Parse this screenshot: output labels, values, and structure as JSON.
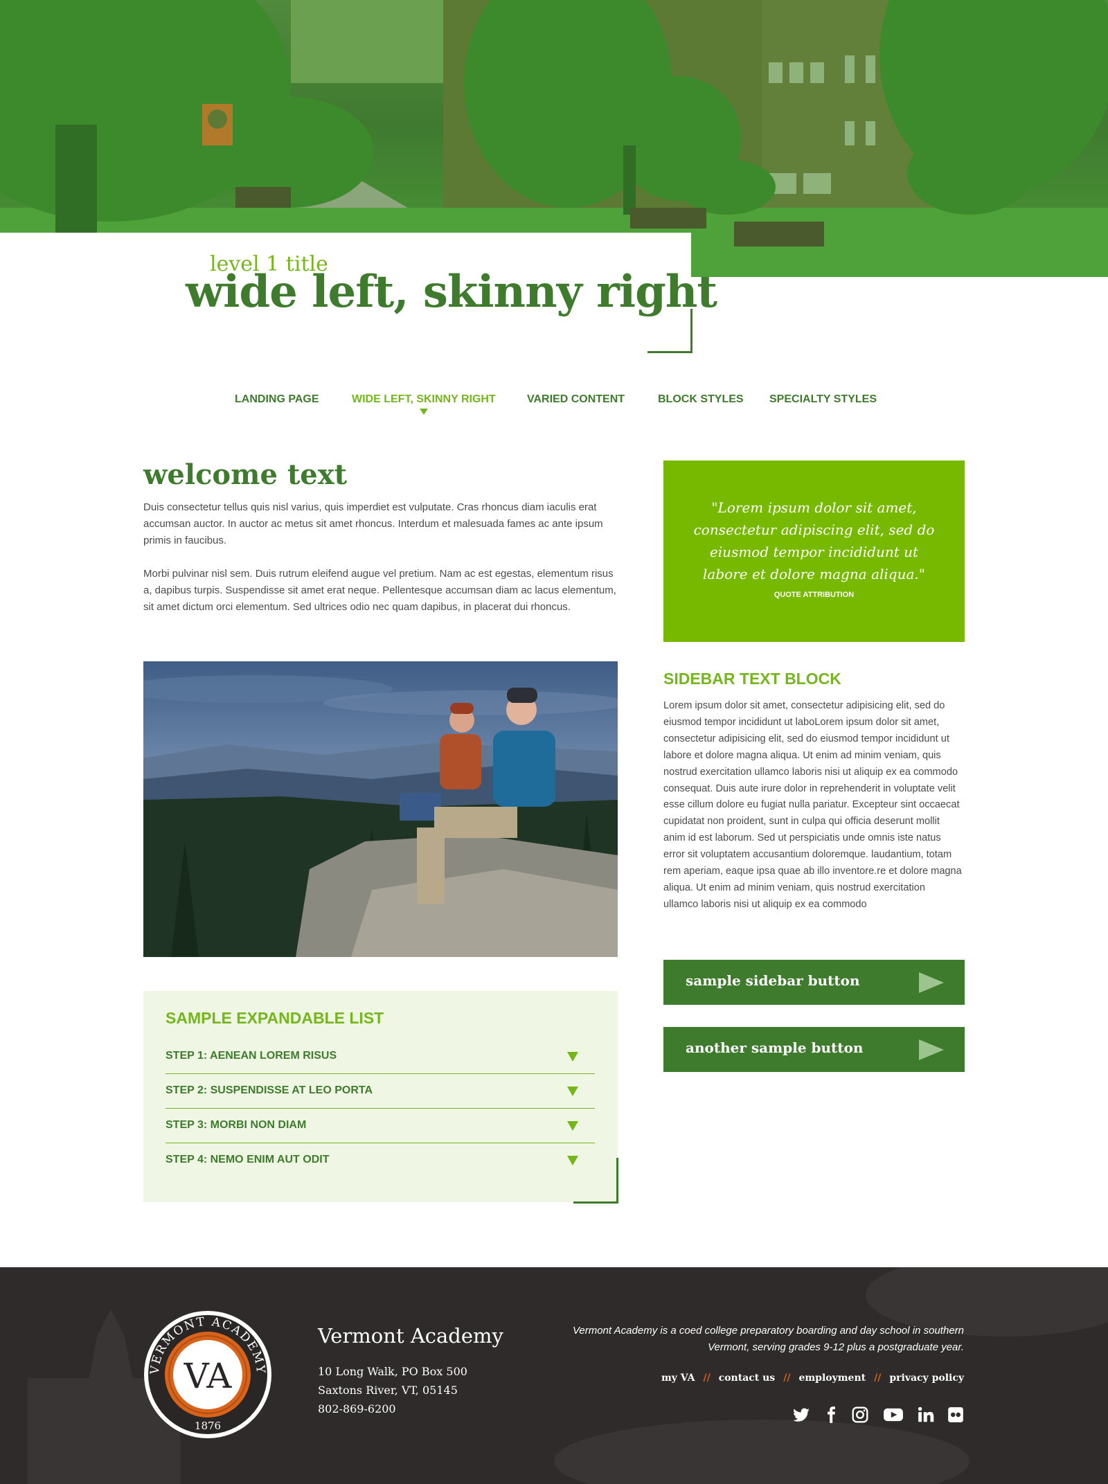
{
  "hero": {
    "kicker": "level 1 title",
    "title": "wide left, skinny right"
  },
  "nav": {
    "items": [
      {
        "label": "LANDING PAGE"
      },
      {
        "label": "WIDE LEFT, SKINNY RIGHT",
        "active": true
      },
      {
        "label": "VARIED CONTENT"
      },
      {
        "label": "BLOCK STYLES"
      },
      {
        "label": "SPECIALTY STYLES"
      }
    ]
  },
  "main": {
    "heading": "welcome text",
    "paragraphs": [
      "Duis consectetur tellus quis nisl varius, quis imperdiet est vulputate. Cras rhoncus diam iaculis erat accumsan auctor. In auctor ac metus sit amet rhoncus. Interdum et malesuada fames ac ante ipsum primis in faucibus.",
      "Morbi pulvinar nisl sem. Duis rutrum eleifend augue vel pretium. Nam ac est egestas, elementum risus a, dapibus turpis. Suspendisse sit amet erat neque. Pellentesque accumsan diam ac lacus elementum, sit amet dictum orci elementum. Sed ultrices odio nec quam dapibus, in placerat dui rhoncus."
    ],
    "expandable": {
      "title": "SAMPLE EXPANDABLE LIST",
      "items": [
        {
          "label": "STEP 1: AENEAN LOREM RISUS"
        },
        {
          "label": "STEP 2: SUSPENDISSE AT LEO PORTA"
        },
        {
          "label": "STEP 3: MORBI NON DIAM"
        },
        {
          "label": "STEP 4: NEMO ENIM AUT ODIT"
        }
      ]
    }
  },
  "sidebar": {
    "quote": "\"Lorem ipsum dolor sit amet, consectetur adipiscing elit, sed do eiusmod tempor incididunt ut labore et dolore magna aliqua.\"",
    "quote_attribution": "QUOTE ATTRIBUTION",
    "text_block_title": "SIDEBAR TEXT BLOCK",
    "text_block": "Lorem ipsum dolor sit amet, consectetur adipisicing elit, sed do eiusmod tempor incididunt ut laboLorem ipsum dolor sit amet, consectetur adipisicing elit, sed do eiusmod tempor incididunt ut labore et dolore magna aliqua. Ut enim ad minim veniam, quis nostrud exercitation ullamco laboris nisi ut aliquip ex ea commodo consequat. Duis aute irure dolor in reprehenderit in voluptate velit esse cillum dolore eu fugiat nulla pariatur. Excepteur sint occaecat cupidatat non proident, sunt in culpa qui officia deserunt mollit anim id est laborum. Sed ut perspiciatis unde omnis iste natus error sit voluptatem accusantium doloremque. laudantium, totam rem aperiam, eaque ipsa quae ab illo inventore.re et dolore magna aliqua. Ut enim ad minim veniam, quis nostrud exercitation ullamco laboris nisi ut aliquip ex ea commodo",
    "buttons": [
      {
        "label": "sample sidebar button"
      },
      {
        "label": "another sample button"
      }
    ]
  },
  "footer": {
    "seal_text": "VERMONT ACADEMY",
    "seal_monogram": "VA",
    "seal_year": "1876",
    "name": "Vermont Academy",
    "address_lines": [
      "10 Long Walk, PO Box 500",
      "Saxtons River, VT, 05145",
      "802-869-6200"
    ],
    "description": "Vermont Academy is a coed college preparatory boarding and day school in southern Vermont, serving grades 9-12 plus a postgraduate year.",
    "links": [
      {
        "label": "my VA"
      },
      {
        "label": "contact us"
      },
      {
        "label": "employment"
      },
      {
        "label": "privacy policy"
      }
    ],
    "separator": "//",
    "social_icons": [
      "twitter-icon",
      "facebook-icon",
      "instagram-icon",
      "youtube-icon",
      "linkedin-icon",
      "flickr-icon"
    ]
  },
  "colors": {
    "brand_green_dark": "#3e7b2d",
    "brand_green_light": "#76b900",
    "footer_bg": "#2f2b2b",
    "accent_orange": "#d8641c",
    "expandable_bg": "#eff6e4"
  }
}
